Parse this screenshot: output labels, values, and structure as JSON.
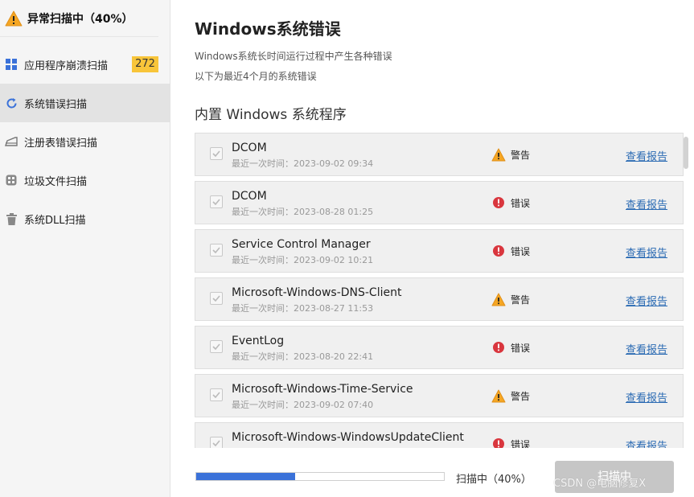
{
  "sidebar": {
    "header_title": "异常扫描中（40%）",
    "items": [
      {
        "label": "应用程序崩溃扫描",
        "icon": "grid-icon",
        "badge": "272"
      },
      {
        "label": "系统错误扫描",
        "icon": "refresh-icon"
      },
      {
        "label": "注册表错误扫描",
        "icon": "registry-icon"
      },
      {
        "label": "垃圾文件扫描",
        "icon": "junk-files-icon"
      },
      {
        "label": "系统DLL扫描",
        "icon": "trash-icon"
      }
    ]
  },
  "main": {
    "title": "Windows系统错误",
    "desc1": "Windows系统长时间运行过程中产生各种错误",
    "desc2": "以下为最近4个月的系统错误",
    "section_title": "内置 Windows 系统程序",
    "rows": [
      {
        "name": "DCOM",
        "time": "最近一次时间：2023-09-02 09:34",
        "status": "警告",
        "status_type": "warning",
        "link": "查看报告"
      },
      {
        "name": "DCOM",
        "time": "最近一次时间：2023-08-28 01:25",
        "status": "错误",
        "status_type": "error",
        "link": "查看报告"
      },
      {
        "name": "Service Control Manager",
        "time": "最近一次时间：2023-09-02 10:21",
        "status": "错误",
        "status_type": "error",
        "link": "查看报告"
      },
      {
        "name": "Microsoft-Windows-DNS-Client",
        "time": "最近一次时间：2023-08-27 11:53",
        "status": "警告",
        "status_type": "warning",
        "link": "查看报告"
      },
      {
        "name": "EventLog",
        "time": "最近一次时间：2023-08-20 22:41",
        "status": "错误",
        "status_type": "error",
        "link": "查看报告"
      },
      {
        "name": "Microsoft-Windows-Time-Service",
        "time": "最近一次时间：2023-09-02 07:40",
        "status": "警告",
        "status_type": "warning",
        "link": "查看报告"
      },
      {
        "name": "Microsoft-Windows-WindowsUpdateClient",
        "time": "",
        "status": "错误",
        "status_type": "error",
        "link": "查看报告"
      }
    ]
  },
  "footer": {
    "progress_percent": 40,
    "progress_text": "扫描中（40%）",
    "scan_button": "扫描中",
    "watermark": "CSDN @电脑修复X"
  },
  "colors": {
    "warning": "#f5a623",
    "error": "#d9363e",
    "accent": "#3b72d9",
    "link": "#2a6ab3",
    "badge": "#f8c53a"
  }
}
